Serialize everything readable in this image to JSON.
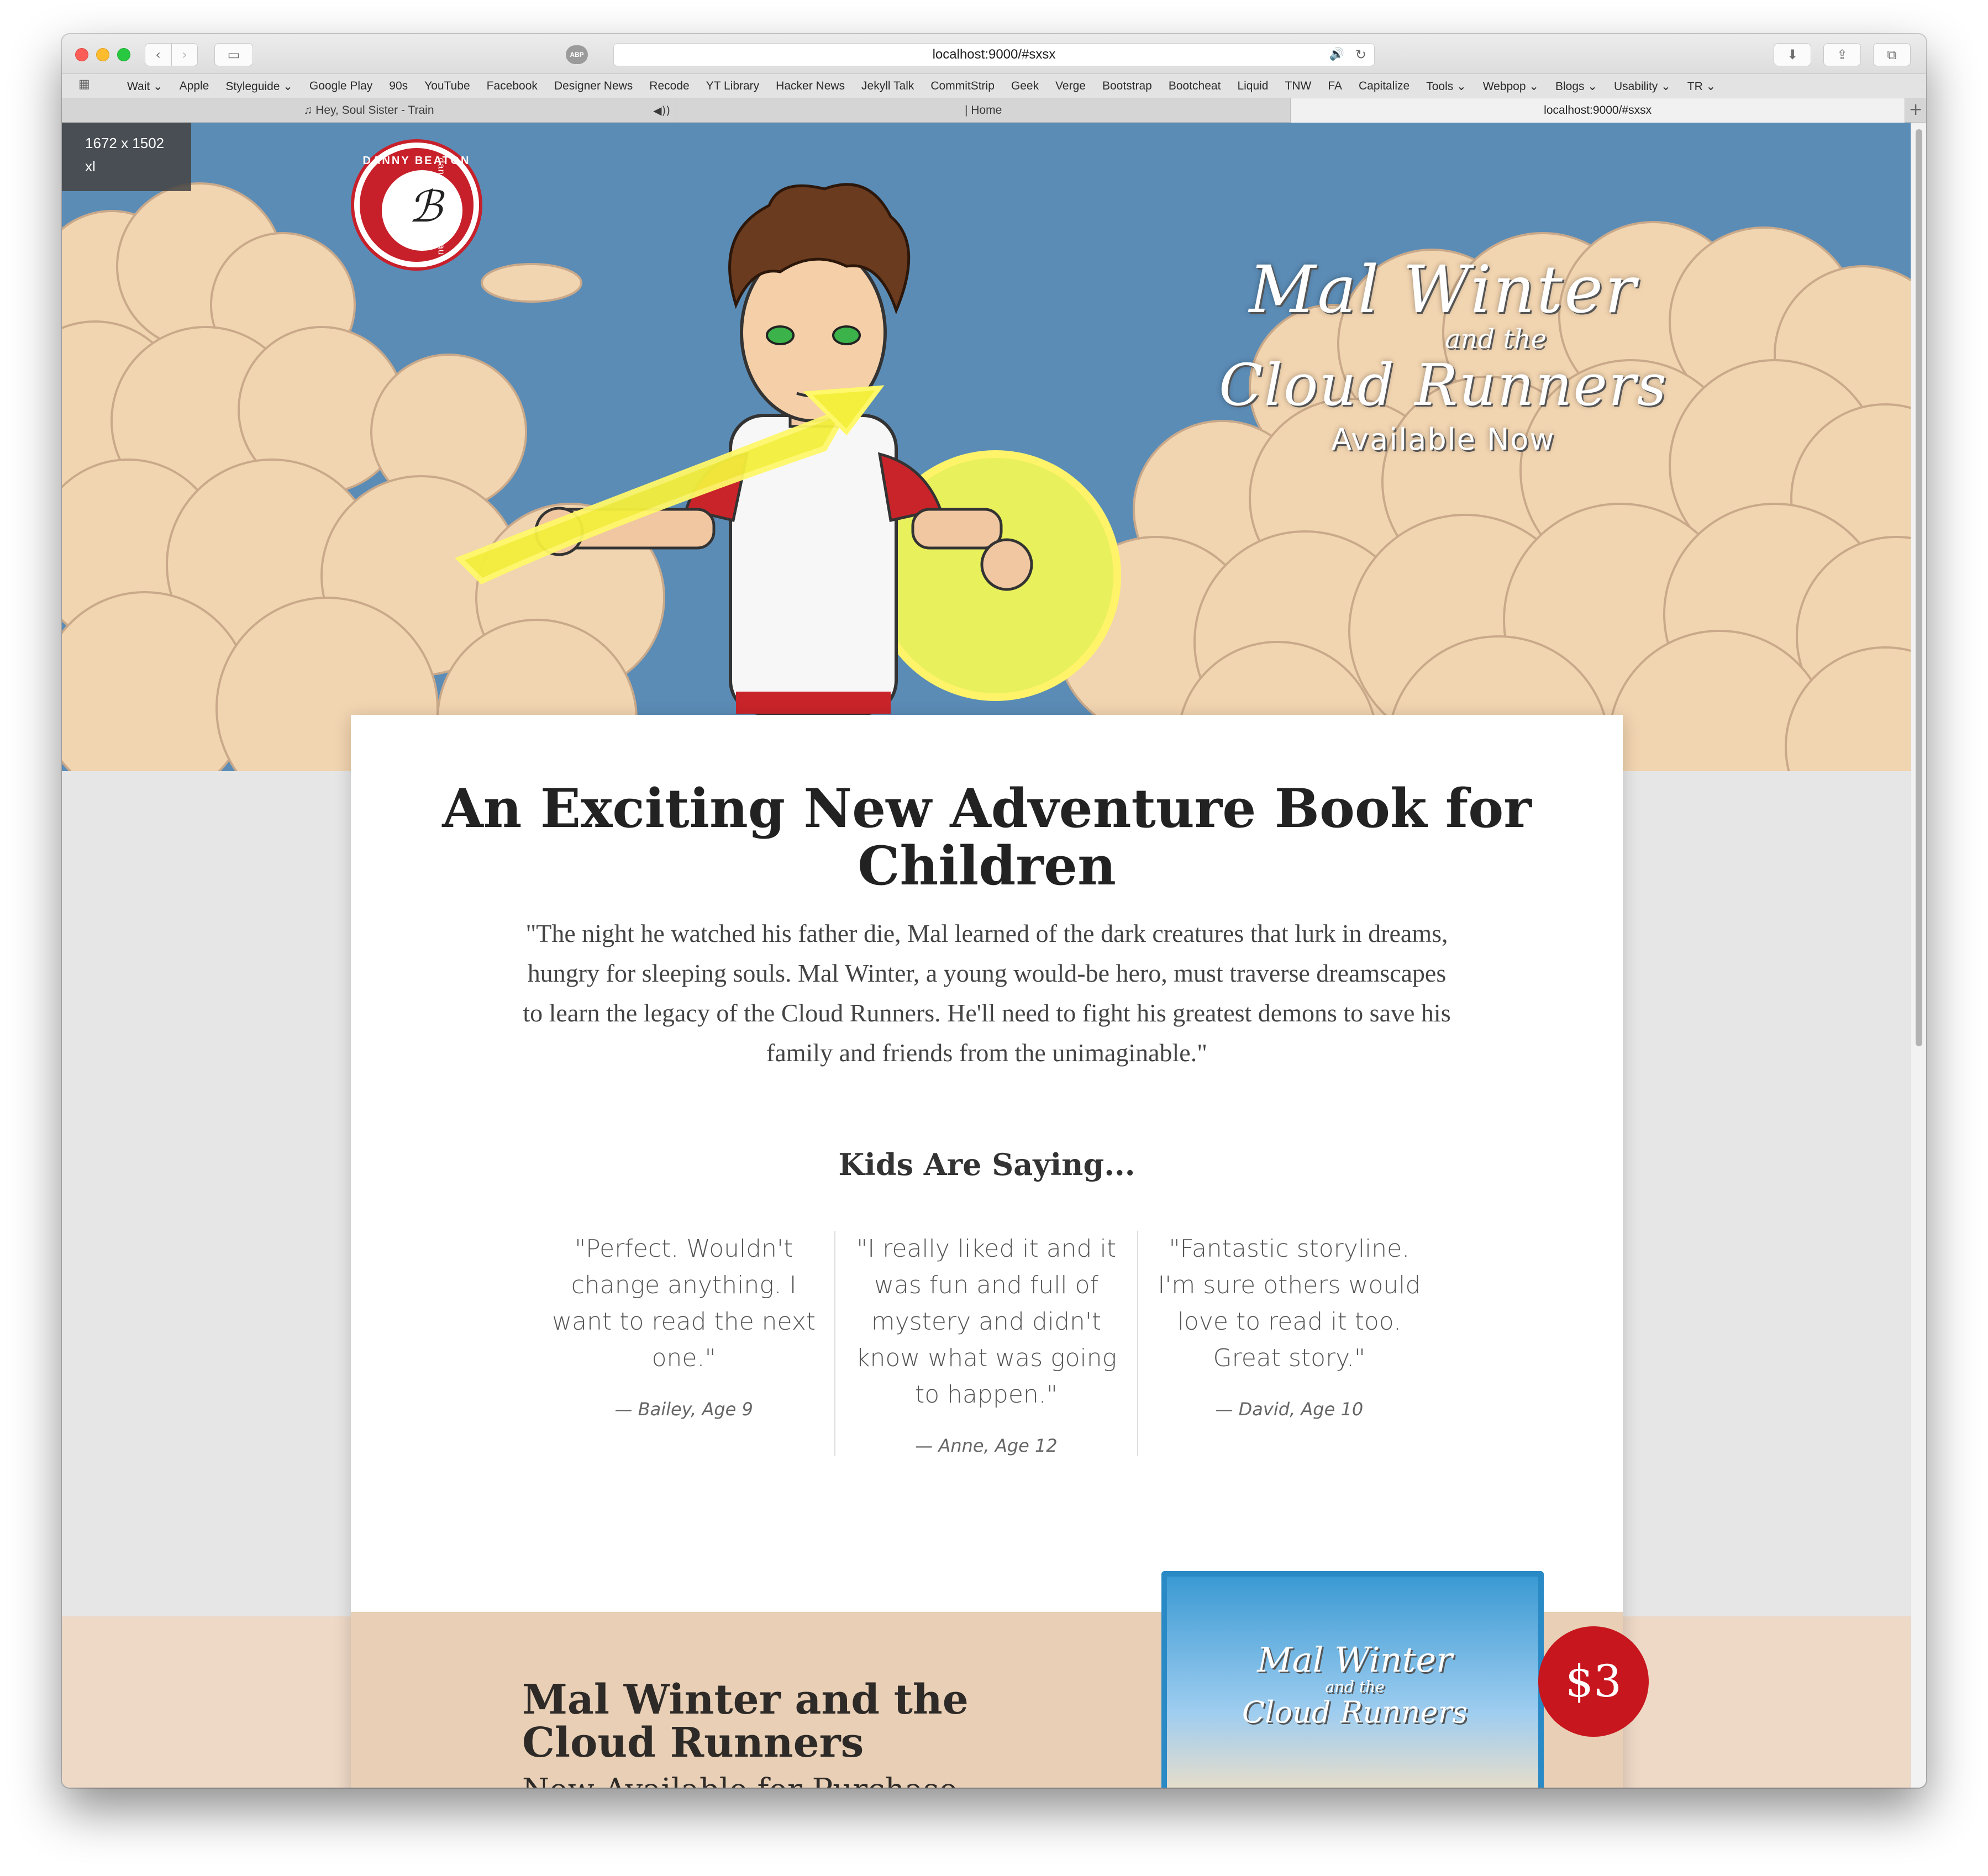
{
  "browser": {
    "url": "localhost:9000/#sxsx",
    "abp_label": "ABP",
    "bookmarks": [
      "Wait ⌄",
      "Apple",
      "Styleguide ⌄",
      "Google Play",
      "90s",
      "YouTube",
      "Facebook",
      "Designer News",
      "Recode",
      "YT Library",
      "Hacker News",
      "Jekyll Talk",
      "CommitStrip",
      "Geek",
      "Verge",
      "Bootstrap",
      "Bootcheat",
      "Liquid",
      "TNW",
      "FA",
      "Capitalize",
      "Tools ⌄",
      "Webpop ⌄",
      "Blogs ⌄",
      "Usability ⌄",
      "TR ⌄"
    ],
    "tabs": [
      {
        "label": "♫ Hey, Soul Sister - Train",
        "audio": "◀))"
      },
      {
        "label": "| Home"
      },
      {
        "label": "localhost:9000/#sxsx"
      }
    ]
  },
  "viewport_badge": {
    "size": "1672 x 1502",
    "breakpoint": "xl"
  },
  "logo": {
    "top_text": "DANNY BEATON",
    "side_text": "dannybeaton.com.au"
  },
  "hero": {
    "title_line1": "Mal Winter",
    "title_line2": "and the",
    "title_line3": "Cloud Runners",
    "tagline": "Available Now"
  },
  "content": {
    "headline": "An Exciting New Adventure Book for Children",
    "synopsis": "\"The night he watched his father die, Mal learned of the dark creatures that lurk in dreams, hungry for sleeping souls. Mal Winter, a young would-be hero, must traverse dreamscapes to learn the legacy of the Cloud Runners. He'll need to fight his greatest demons to save his family and friends from the unimaginable.\"",
    "kids_heading": "Kids Are Saying...",
    "quotes": [
      {
        "text": "\"Perfect. Wouldn't change anything. I want to read the next one.\"",
        "author": "— Bailey, Age 9"
      },
      {
        "text": "\"I really liked it and it was fun and full of mystery and didn't know what was going to happen.\"",
        "author": "— Anne, Age 12"
      },
      {
        "text": "\"Fantastic storyline. I'm sure others would love to read it too. Great story.\"",
        "author": "— David, Age 10"
      }
    ]
  },
  "purchase": {
    "title": "Mal Winter and the Cloud Runners",
    "subtitle": "Now Available for Purchase",
    "price": "$3",
    "book_title_line1": "Mal Winter",
    "book_title_line2": "and the",
    "book_title_line3": "Cloud Runners"
  },
  "colors": {
    "sky": "#5b8cb6",
    "accent_red": "#c8202a",
    "band": "#e8cfb5"
  }
}
